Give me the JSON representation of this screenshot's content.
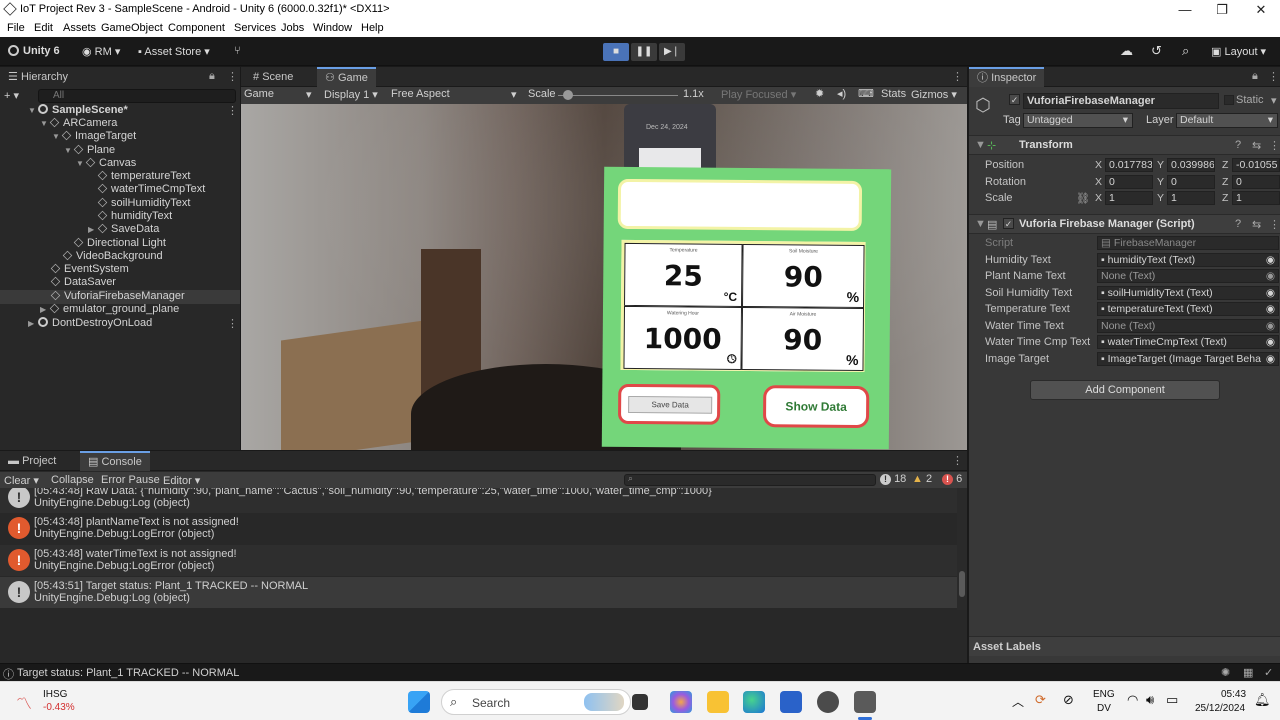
{
  "window": {
    "title": "IoT Project Rev 3 - SampleScene - Android - Unity 6 (6000.0.32f1)* <DX11>"
  },
  "menu": [
    "File",
    "Edit",
    "Assets",
    "GameObject",
    "Component",
    "Services",
    "Jobs",
    "Window",
    "Help"
  ],
  "toolbar": {
    "unity_label": "Unity 6",
    "account": "RM",
    "asset_store": "Asset Store",
    "layout": "Layout"
  },
  "hierarchy": {
    "tab": "Hierarchy",
    "search_placeholder": "All",
    "items": [
      {
        "label": "SampleScene*"
      },
      {
        "label": "ARCamera"
      },
      {
        "label": "ImageTarget"
      },
      {
        "label": "Plane"
      },
      {
        "label": "Canvas"
      },
      {
        "label": "temperatureText"
      },
      {
        "label": "waterTimeCmpText"
      },
      {
        "label": "soilHumidityText"
      },
      {
        "label": "humidityText"
      },
      {
        "label": "SaveData"
      },
      {
        "label": "Directional Light"
      },
      {
        "label": "VideoBackground"
      },
      {
        "label": "EventSystem"
      },
      {
        "label": "DataSaver"
      },
      {
        "label": "VuforiaFirebaseManager"
      },
      {
        "label": "emulator_ground_plane"
      },
      {
        "label": "DontDestroyOnLoad"
      }
    ]
  },
  "game": {
    "tabs": [
      "Scene",
      "Game"
    ],
    "mode": "Game",
    "display": "Display 1",
    "aspect": "Free Aspect",
    "scale_label": "Scale",
    "scale_value": "1.1x",
    "play_focused": "Play Focused",
    "stats": "Stats",
    "gizmos": "Gizmos",
    "phone_date": "Dec 24, 2024",
    "card": {
      "cells": [
        {
          "caption": "Temperature",
          "value": "25",
          "unit": "°C"
        },
        {
          "caption": "Soil Moisture",
          "value": "90",
          "unit": "%"
        },
        {
          "caption": "Watering Hour",
          "value": "1000",
          "unit": ""
        },
        {
          "caption": "Air Moisture",
          "value": "90",
          "unit": "%"
        }
      ],
      "save_button": "Save Data",
      "show_button": "Show Data"
    }
  },
  "inspector": {
    "tab": "Inspector",
    "object_name": "VuforiaFirebaseManager",
    "static_label": "Static",
    "tag_label": "Tag",
    "tag_value": "Untagged",
    "layer_label": "Layer",
    "layer_value": "Default",
    "transform": {
      "title": "Transform",
      "position": {
        "label": "Position",
        "x": "0.017783",
        "y": "0.039986",
        "z": "-0.01055"
      },
      "rotation": {
        "label": "Rotation",
        "x": "0",
        "y": "0",
        "z": "0"
      },
      "scale": {
        "label": "Scale",
        "x": "1",
        "y": "1",
        "z": "1"
      }
    },
    "script_component": {
      "title": "Vuforia Firebase Manager (Script)",
      "fields": [
        {
          "label": "Script",
          "value": "FirebaseManager",
          "dim": true
        },
        {
          "label": "Humidity Text",
          "value": "humidityText (Text)"
        },
        {
          "label": "Plant Name Text",
          "value": "None (Text)"
        },
        {
          "label": "Soil Humidity Text",
          "value": "soilHumidityText (Text)"
        },
        {
          "label": "Temperature Text",
          "value": "temperatureText (Text)"
        },
        {
          "label": "Water Time Text",
          "value": "None (Text)"
        },
        {
          "label": "Water Time Cmp Text",
          "value": "waterTimeCmpText (Text)"
        },
        {
          "label": "Image Target",
          "value": "ImageTarget (Image Target Beha"
        }
      ]
    },
    "add_component": "Add Component",
    "asset_labels": "Asset Labels"
  },
  "console": {
    "tabs": [
      "Project",
      "Console"
    ],
    "buttons": {
      "clear": "Clear",
      "collapse": "Collapse",
      "error_pause": "Error Pause",
      "editor": "Editor"
    },
    "counts": {
      "log": "18",
      "warn": "2",
      "error": "6"
    },
    "logs": [
      {
        "type": "log",
        "line1": "[05:43:48] Raw Data: {\"humidity\":90,\"plant_name\":\"Cactus\",\"soil_humidity\":90,\"temperature\":25,\"water_time\":1000,\"water_time_cmp\":1000}",
        "line2": "UnityEngine.Debug:Log (object)"
      },
      {
        "type": "error",
        "line1": "[05:43:48] plantNameText is not assigned!",
        "line2": "UnityEngine.Debug:LogError (object)"
      },
      {
        "type": "error",
        "line1": "[05:43:48] waterTimeText is not assigned!",
        "line2": "UnityEngine.Debug:LogError (object)"
      },
      {
        "type": "log",
        "line1": "[05:43:51] Target status: Plant_1 TRACKED -- NORMAL",
        "line2": "UnityEngine.Debug:Log (object)"
      }
    ]
  },
  "status": {
    "text": "Target status: Plant_1 TRACKED -- NORMAL"
  },
  "taskbar": {
    "stock_name": "IHSG",
    "stock_change": "-0.43%",
    "search": "Search",
    "lang1": "ENG",
    "lang2": "DV",
    "time": "05:43",
    "date": "25/12/2024"
  }
}
